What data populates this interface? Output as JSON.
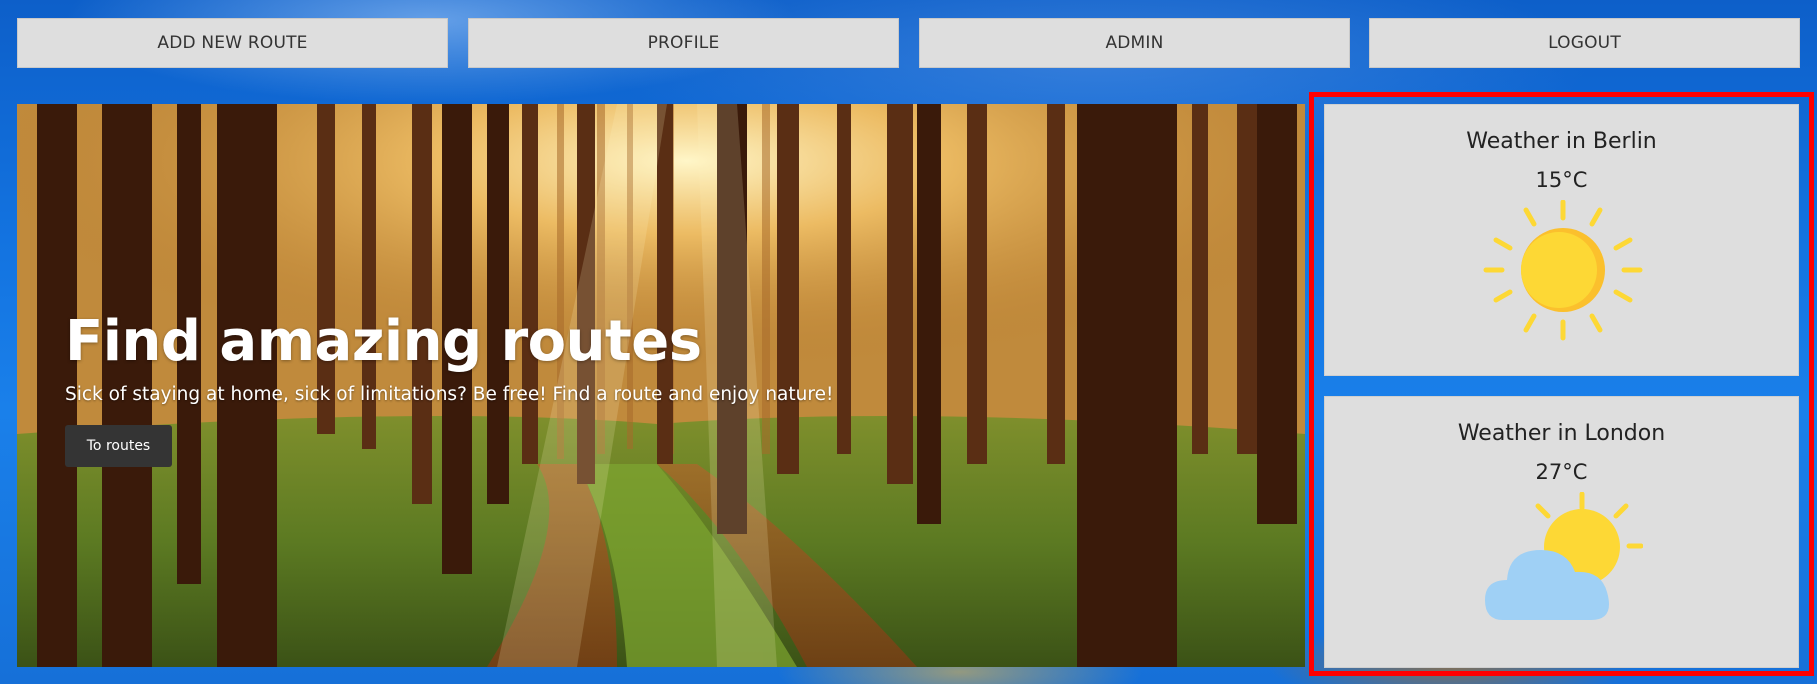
{
  "nav": {
    "items": [
      {
        "label": "ADD NEW ROUTE"
      },
      {
        "label": "PROFILE"
      },
      {
        "label": "ADMIN"
      },
      {
        "label": "LOGOUT"
      }
    ]
  },
  "hero": {
    "title": "Find amazing routes",
    "subtitle": "Sick of staying at home, sick of limitations? Be free! Find a route and enjoy nature!",
    "button_label": "To routes",
    "background_image": "forest-path-image"
  },
  "weather": [
    {
      "title": "Weather in Berlin",
      "temperature": "15°C",
      "icon": "sun-icon"
    },
    {
      "title": "Weather in London",
      "temperature": "27°C",
      "icon": "partly-cloudy-icon"
    }
  ],
  "colors": {
    "nav_button_bg": "#dedede",
    "hero_button_bg": "#343434",
    "highlight_border": "#ff0000",
    "sun_yellow": "#fdd835",
    "sun_shade": "#fbc02d",
    "cloud_blue": "#9fd0f5"
  }
}
